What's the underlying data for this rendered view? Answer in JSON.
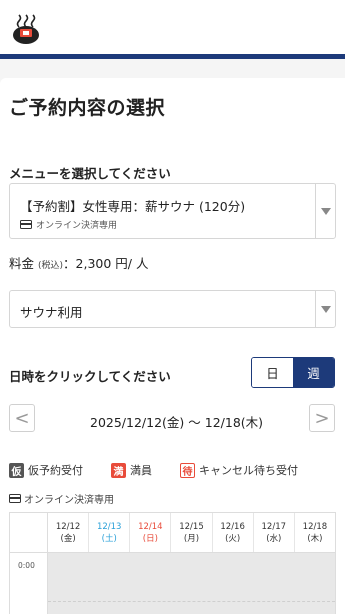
{
  "header": {
    "logo_icon": "onsen-logo-icon",
    "accent": "#1d3a7a"
  },
  "page": {
    "title": "ご予約内容の選択"
  },
  "menu": {
    "section_label": "メニューを選択してください",
    "selected": "【予約割】女性専用：薪サウナ (120分)",
    "payment_note": "オンライン決済専用"
  },
  "price": {
    "label": "料金",
    "tax_note": "(税込)",
    "value": "：2,300 円/ 人"
  },
  "sauna_select": {
    "selected": "サウナ利用"
  },
  "datetime": {
    "section_label": "日時をクリックしてください",
    "view_toggle": {
      "day": "日",
      "week": "週",
      "active": "week"
    },
    "range": "2025/12/12(金) 〜 12/18(木)",
    "prev": "<",
    "next": ">"
  },
  "legend": {
    "kari_badge": "仮",
    "kari_label": "仮予約受付",
    "man_badge": "満",
    "man_label": "満員",
    "machi_badge": "待",
    "machi_label": "キャンセル待ち受付",
    "online_only": "オンライン決済専用"
  },
  "calendar": {
    "days": [
      {
        "date": "12/12",
        "dow": "(金)",
        "color": "#333333"
      },
      {
        "date": "12/13",
        "dow": "(土)",
        "color": "#2aa0d8"
      },
      {
        "date": "12/14",
        "dow": "(日)",
        "color": "#e84b3a"
      },
      {
        "date": "12/15",
        "dow": "(月)",
        "color": "#333333"
      },
      {
        "date": "12/16",
        "dow": "(火)",
        "color": "#333333"
      },
      {
        "date": "12/17",
        "dow": "(水)",
        "color": "#333333"
      },
      {
        "date": "12/18",
        "dow": "(木)",
        "color": "#333333"
      }
    ],
    "first_time": "0:00"
  }
}
